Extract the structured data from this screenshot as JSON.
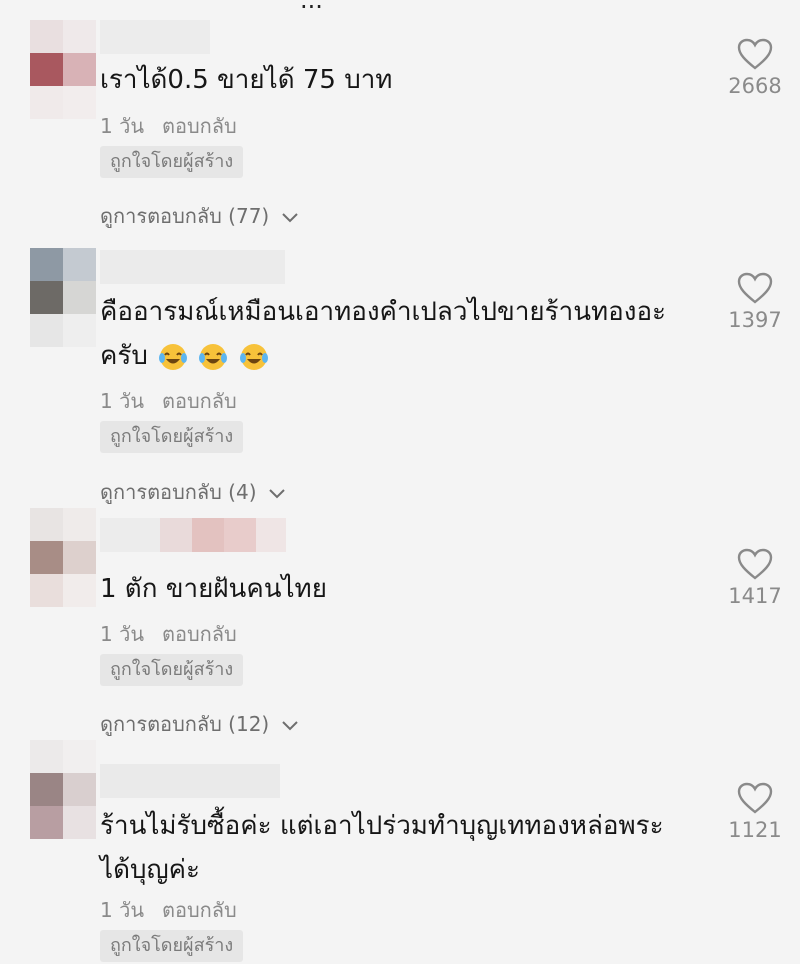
{
  "top_cut_text": "...",
  "comments": [
    {
      "text": "เราได้0.5 ขายได้ 75 บาท",
      "age": "1 วัน",
      "reply_label": "ตอบกลับ",
      "creator_badge": "ถูกใจโดยผู้สร้าง",
      "view_replies": "ดูการตอบกลับ (77)",
      "likes": "2668"
    },
    {
      "text": "คืออารมณ์เหมือนเอาทองคำเปลวไปขายร้านทองอะ",
      "text_line2": "ครับ",
      "emoji": "face-with-tears-of-joy",
      "age": "1 วัน",
      "reply_label": "ตอบกลับ",
      "creator_badge": "ถูกใจโดยผู้สร้าง",
      "view_replies": "ดูการตอบกลับ (4)",
      "likes": "1397"
    },
    {
      "text": "1 ตัก ขายฝันคนไทย",
      "age": "1 วัน",
      "reply_label": "ตอบกลับ",
      "creator_badge": "ถูกใจโดยผู้สร้าง",
      "view_replies": "ดูการตอบกลับ (12)",
      "likes": "1417"
    },
    {
      "text": "ร้านไม่รับซื้อค่ะ แต่เอาไปร่วมทำบุญเททองหล่อพระ",
      "text_line2": "ได้บุญค่ะ",
      "age": "1 วัน",
      "reply_label": "ตอบกลับ",
      "creator_badge": "ถูกใจโดยผู้สร้าง",
      "likes": "1121"
    }
  ],
  "colors": {
    "background": "#f4f4f4",
    "text": "#161616",
    "muted": "#8a8a8a",
    "badge_bg": "#e6e6e6"
  }
}
